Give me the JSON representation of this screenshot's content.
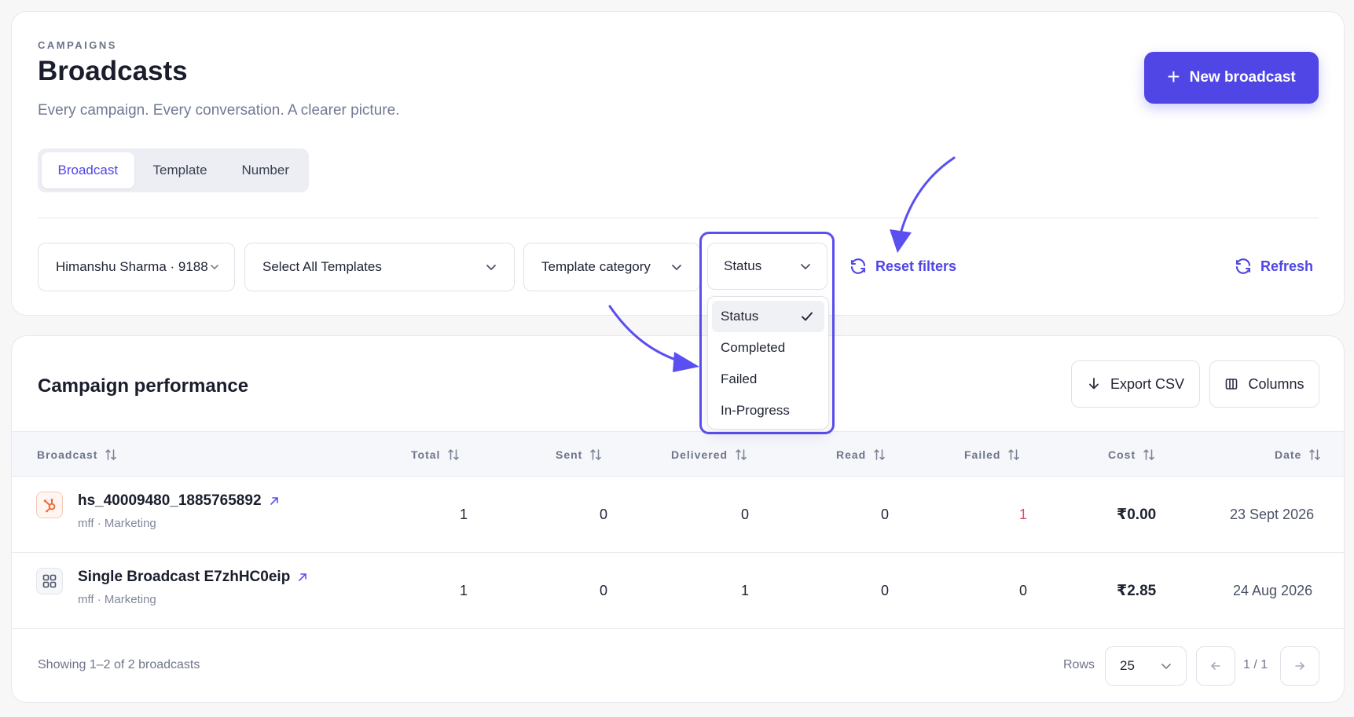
{
  "header": {
    "eyebrow": "CAMPAIGNS",
    "title": "Broadcasts",
    "subtitle": "Every campaign. Every conversation. A clearer picture.",
    "new_button_label": "New broadcast"
  },
  "tabs": [
    {
      "label": "Broadcast",
      "active": true
    },
    {
      "label": "Template",
      "active": false
    },
    {
      "label": "Number",
      "active": false
    }
  ],
  "filters": {
    "account": "Himanshu Sharma · 9188",
    "templates": "Select All Templates",
    "category": "Template category",
    "status": "Status",
    "reset_label": "Reset filters",
    "refresh_label": "Refresh",
    "status_options": [
      "Status",
      "Completed",
      "Failed",
      "In-Progress"
    ],
    "status_selected": "Status"
  },
  "performance": {
    "title": "Campaign performance",
    "export_label": "Export CSV",
    "columns_label": "Columns",
    "headers": [
      "Broadcast",
      "Total",
      "Sent",
      "Delivered",
      "Read",
      "Failed",
      "Cost",
      "Date"
    ],
    "rows": [
      {
        "name": "hs_40009480_1885765892",
        "meta": "mff · Marketing",
        "icon": "hubspot-icon",
        "total": "1",
        "sent": "0",
        "delivered": "0",
        "read": "0",
        "failed": "1",
        "cost": "₹0.00",
        "date": "23 Sept 2026"
      },
      {
        "name": "Single Broadcast E7zhHC0eip",
        "meta": "mff · Marketing",
        "icon": "grid-icon",
        "total": "1",
        "sent": "0",
        "delivered": "1",
        "read": "0",
        "failed": "0",
        "cost": "₹2.85",
        "date": "24 Aug 2026"
      }
    ]
  },
  "footer": {
    "showing": "Showing 1–2 of 2 broadcasts",
    "rows_label": "Rows",
    "rows_value": "25",
    "page": "1 / 1"
  },
  "colors": {
    "accent": "#4f46e5",
    "failed": "#e04a5f"
  }
}
